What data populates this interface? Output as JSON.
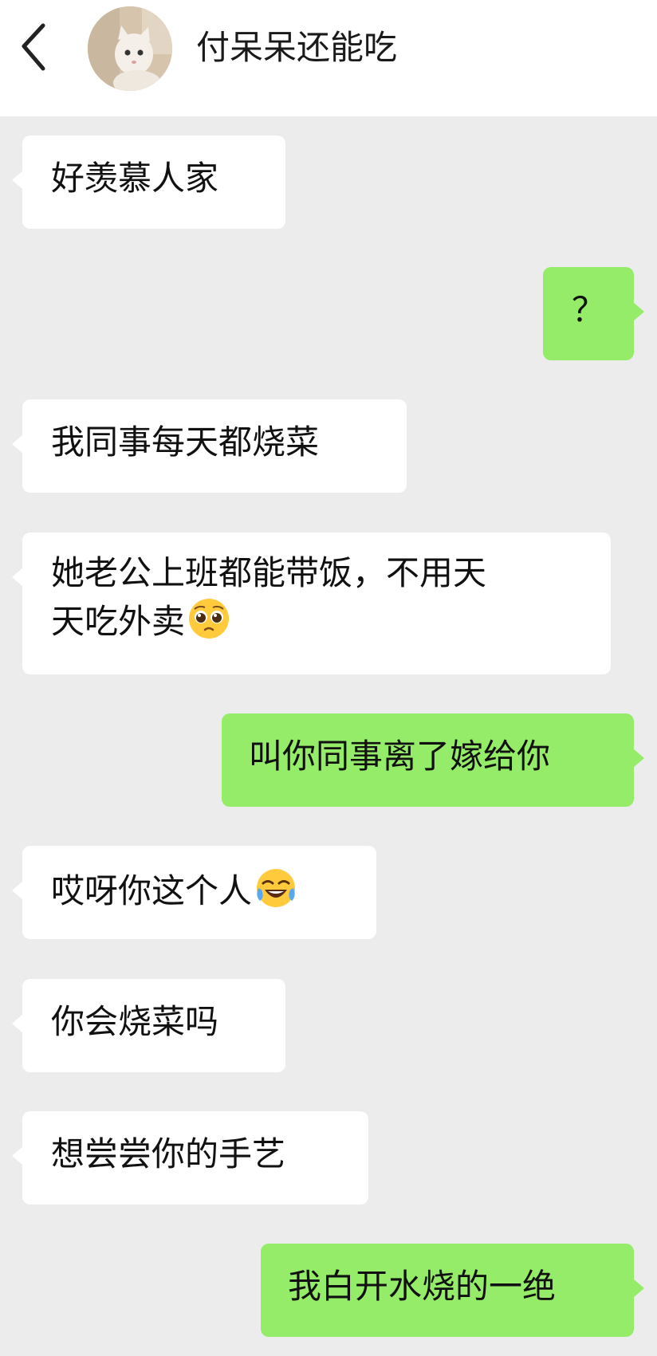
{
  "header": {
    "contact_name": "付呆呆还能吃"
  },
  "messages": [
    {
      "side": "in",
      "text": "好羡慕人家"
    },
    {
      "side": "out",
      "text": "？"
    },
    {
      "side": "in",
      "text": "我同事每天都烧菜"
    },
    {
      "side": "in",
      "line1": "她老公上班都能带饭，不用天",
      "line2": "天吃外卖",
      "emoji": "pleading-face-icon"
    },
    {
      "side": "out",
      "text": "叫你同事离了嫁给你"
    },
    {
      "side": "in",
      "text": "哎呀你这个人",
      "emoji": "tears-of-joy-icon"
    },
    {
      "side": "in",
      "text": "你会烧菜吗"
    },
    {
      "side": "in",
      "text": "想尝尝你的手艺"
    },
    {
      "side": "out",
      "text": "我白开水烧的一绝"
    }
  ],
  "colors": {
    "outgoing_bubble": "#95ec69",
    "incoming_bubble": "#ffffff",
    "chat_background": "#ececec"
  }
}
